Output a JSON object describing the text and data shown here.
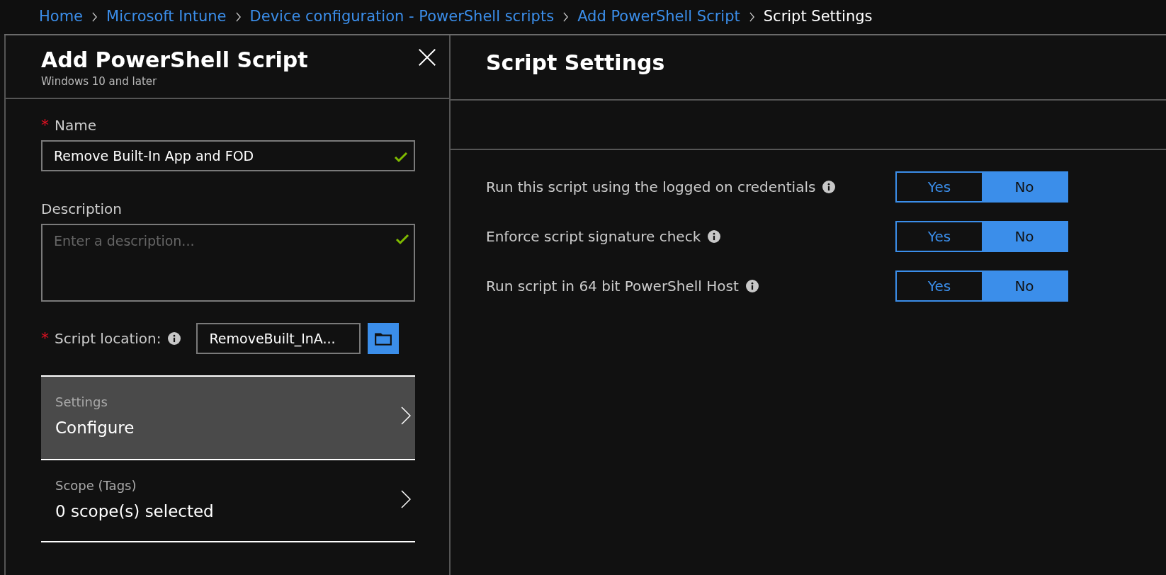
{
  "breadcrumb": [
    {
      "label": "Home",
      "current": false
    },
    {
      "label": "Microsoft Intune",
      "current": false
    },
    {
      "label": "Device configuration - PowerShell scripts",
      "current": false
    },
    {
      "label": "Add PowerShell Script",
      "current": false
    },
    {
      "label": "Script Settings",
      "current": true
    }
  ],
  "left_blade": {
    "title": "Add PowerShell Script",
    "subtitle": "Windows 10 and later",
    "name_field": {
      "label": "Name",
      "required_mark": "*",
      "value": "Remove Built-In App and FOD",
      "valid": true
    },
    "description_field": {
      "label": "Description",
      "placeholder": "Enter a description...",
      "valid": true
    },
    "script_location": {
      "label": "Script location:",
      "required_mark": "*",
      "value": "RemoveBuilt_InA..."
    },
    "nav_rows": [
      {
        "label": "Settings",
        "value": "Configure",
        "selected": true
      },
      {
        "label": "Scope (Tags)",
        "value": "0 scope(s) selected",
        "selected": false
      }
    ]
  },
  "right_blade": {
    "title": "Script Settings",
    "settings": [
      {
        "label": "Run this script using the logged on credentials",
        "options": [
          {
            "label": "Yes",
            "selected": false
          },
          {
            "label": "No",
            "selected": true
          }
        ]
      },
      {
        "label": "Enforce script signature check",
        "options": [
          {
            "label": "Yes",
            "selected": false
          },
          {
            "label": "No",
            "selected": true
          }
        ]
      },
      {
        "label": "Run script in 64 bit PowerShell Host",
        "options": [
          {
            "label": "Yes",
            "selected": false
          },
          {
            "label": "No",
            "selected": true
          }
        ]
      }
    ]
  }
}
